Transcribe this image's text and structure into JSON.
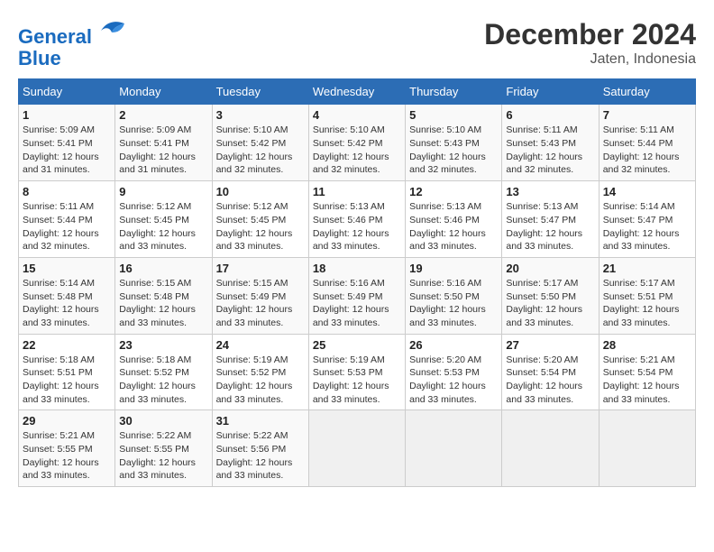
{
  "header": {
    "logo_line1": "General",
    "logo_line2": "Blue",
    "month": "December 2024",
    "location": "Jaten, Indonesia"
  },
  "weekdays": [
    "Sunday",
    "Monday",
    "Tuesday",
    "Wednesday",
    "Thursday",
    "Friday",
    "Saturday"
  ],
  "weeks": [
    [
      {
        "day": "1",
        "sunrise": "5:09 AM",
        "sunset": "5:41 PM",
        "daylight": "12 hours and 31 minutes."
      },
      {
        "day": "2",
        "sunrise": "5:09 AM",
        "sunset": "5:41 PM",
        "daylight": "12 hours and 31 minutes."
      },
      {
        "day": "3",
        "sunrise": "5:10 AM",
        "sunset": "5:42 PM",
        "daylight": "12 hours and 32 minutes."
      },
      {
        "day": "4",
        "sunrise": "5:10 AM",
        "sunset": "5:42 PM",
        "daylight": "12 hours and 32 minutes."
      },
      {
        "day": "5",
        "sunrise": "5:10 AM",
        "sunset": "5:43 PM",
        "daylight": "12 hours and 32 minutes."
      },
      {
        "day": "6",
        "sunrise": "5:11 AM",
        "sunset": "5:43 PM",
        "daylight": "12 hours and 32 minutes."
      },
      {
        "day": "7",
        "sunrise": "5:11 AM",
        "sunset": "5:44 PM",
        "daylight": "12 hours and 32 minutes."
      }
    ],
    [
      {
        "day": "8",
        "sunrise": "5:11 AM",
        "sunset": "5:44 PM",
        "daylight": "12 hours and 32 minutes."
      },
      {
        "day": "9",
        "sunrise": "5:12 AM",
        "sunset": "5:45 PM",
        "daylight": "12 hours and 33 minutes."
      },
      {
        "day": "10",
        "sunrise": "5:12 AM",
        "sunset": "5:45 PM",
        "daylight": "12 hours and 33 minutes."
      },
      {
        "day": "11",
        "sunrise": "5:13 AM",
        "sunset": "5:46 PM",
        "daylight": "12 hours and 33 minutes."
      },
      {
        "day": "12",
        "sunrise": "5:13 AM",
        "sunset": "5:46 PM",
        "daylight": "12 hours and 33 minutes."
      },
      {
        "day": "13",
        "sunrise": "5:13 AM",
        "sunset": "5:47 PM",
        "daylight": "12 hours and 33 minutes."
      },
      {
        "day": "14",
        "sunrise": "5:14 AM",
        "sunset": "5:47 PM",
        "daylight": "12 hours and 33 minutes."
      }
    ],
    [
      {
        "day": "15",
        "sunrise": "5:14 AM",
        "sunset": "5:48 PM",
        "daylight": "12 hours and 33 minutes."
      },
      {
        "day": "16",
        "sunrise": "5:15 AM",
        "sunset": "5:48 PM",
        "daylight": "12 hours and 33 minutes."
      },
      {
        "day": "17",
        "sunrise": "5:15 AM",
        "sunset": "5:49 PM",
        "daylight": "12 hours and 33 minutes."
      },
      {
        "day": "18",
        "sunrise": "5:16 AM",
        "sunset": "5:49 PM",
        "daylight": "12 hours and 33 minutes."
      },
      {
        "day": "19",
        "sunrise": "5:16 AM",
        "sunset": "5:50 PM",
        "daylight": "12 hours and 33 minutes."
      },
      {
        "day": "20",
        "sunrise": "5:17 AM",
        "sunset": "5:50 PM",
        "daylight": "12 hours and 33 minutes."
      },
      {
        "day": "21",
        "sunrise": "5:17 AM",
        "sunset": "5:51 PM",
        "daylight": "12 hours and 33 minutes."
      }
    ],
    [
      {
        "day": "22",
        "sunrise": "5:18 AM",
        "sunset": "5:51 PM",
        "daylight": "12 hours and 33 minutes."
      },
      {
        "day": "23",
        "sunrise": "5:18 AM",
        "sunset": "5:52 PM",
        "daylight": "12 hours and 33 minutes."
      },
      {
        "day": "24",
        "sunrise": "5:19 AM",
        "sunset": "5:52 PM",
        "daylight": "12 hours and 33 minutes."
      },
      {
        "day": "25",
        "sunrise": "5:19 AM",
        "sunset": "5:53 PM",
        "daylight": "12 hours and 33 minutes."
      },
      {
        "day": "26",
        "sunrise": "5:20 AM",
        "sunset": "5:53 PM",
        "daylight": "12 hours and 33 minutes."
      },
      {
        "day": "27",
        "sunrise": "5:20 AM",
        "sunset": "5:54 PM",
        "daylight": "12 hours and 33 minutes."
      },
      {
        "day": "28",
        "sunrise": "5:21 AM",
        "sunset": "5:54 PM",
        "daylight": "12 hours and 33 minutes."
      }
    ],
    [
      {
        "day": "29",
        "sunrise": "5:21 AM",
        "sunset": "5:55 PM",
        "daylight": "12 hours and 33 minutes."
      },
      {
        "day": "30",
        "sunrise": "5:22 AM",
        "sunset": "5:55 PM",
        "daylight": "12 hours and 33 minutes."
      },
      {
        "day": "31",
        "sunrise": "5:22 AM",
        "sunset": "5:56 PM",
        "daylight": "12 hours and 33 minutes."
      },
      null,
      null,
      null,
      null
    ]
  ]
}
